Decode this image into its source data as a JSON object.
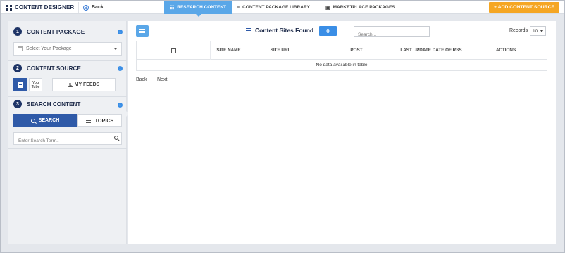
{
  "app": {
    "brand": "CONTENT DESIGNER",
    "back_label": "Back"
  },
  "nav": {
    "tabs": [
      {
        "label": "RESEARCH CONTENT",
        "icon": "rss-icon",
        "active": true
      },
      {
        "label": "CONTENT PACKAGE LIBRARY",
        "icon": "list-icon",
        "active": false
      },
      {
        "label": "MARKETPLACE PACKAGES",
        "icon": "cube-icon",
        "active": false
      }
    ],
    "add_source_label": "+ ADD CONTENT SOURCE"
  },
  "sidebar": {
    "sections": [
      {
        "num": "1",
        "title": "CONTENT PACKAGE"
      },
      {
        "num": "2",
        "title": "CONTENT SOURCE"
      },
      {
        "num": "3",
        "title": "SEARCH CONTENT"
      }
    ],
    "package_select": {
      "value": "Select Your Package"
    },
    "source_buttons": {
      "my_feeds": "MY FEEDS"
    },
    "search": {
      "search_button": "SEARCH",
      "topics_button": "TOPICS",
      "term_placeholder": "Enter Search Term.."
    }
  },
  "main": {
    "sites_found_label": "Content Sites Found",
    "sites_found_count": "0",
    "table_search_placeholder": "Search...",
    "records_label": "Records",
    "records_value": "10",
    "columns": [
      "SITE NAME",
      "SITE URL",
      "POST",
      "LAST UPDATE DATE OF RSS",
      "ACTIONS"
    ],
    "empty_text": "No data available in table",
    "pager": {
      "back": "Back",
      "next": "Next"
    }
  },
  "colors": {
    "accent_blue": "#5aa7e8",
    "primary_navy": "#2f5aa8",
    "orange": "#f5a623",
    "badge_blue": "#3a8ee6"
  }
}
